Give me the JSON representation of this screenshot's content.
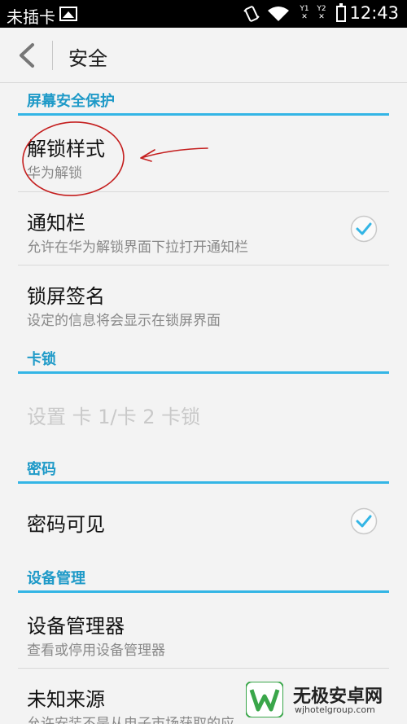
{
  "status_bar": {
    "carrier": "未插卡",
    "sim1": "Y1",
    "sim2": "Y2",
    "time": "12:43"
  },
  "action_bar": {
    "title": "安全"
  },
  "sections": {
    "screen": {
      "header": "屏幕安全保护",
      "unlock_style": {
        "title": "解锁样式",
        "subtitle": "华为解锁"
      },
      "notification": {
        "title": "通知栏",
        "subtitle": "允许在华为解锁界面下拉打开通知栏",
        "checked": true
      },
      "lock_signature": {
        "title": "锁屏签名",
        "subtitle": "设定的信息将会显示在锁屏界面"
      }
    },
    "sim_lock": {
      "header": "卡锁",
      "setup": {
        "title": "设置 卡 1/卡 2 卡锁",
        "enabled": false
      }
    },
    "password": {
      "header": "密码",
      "visible": {
        "title": "密码可见",
        "checked": true
      }
    },
    "device_admin": {
      "header": "设备管理",
      "admins": {
        "title": "设备管理器",
        "subtitle": "查看或停用设备管理器"
      },
      "unknown_sources": {
        "title": "未知来源",
        "subtitle": "允许安装不是从电子市场获取的应"
      }
    }
  },
  "watermark": {
    "name": "无极安卓网",
    "url": "wjhotelgroup.com"
  },
  "colors": {
    "accent": "#33b5e5",
    "header_text": "#1f9ac8",
    "annotation": "#c41e1e"
  }
}
